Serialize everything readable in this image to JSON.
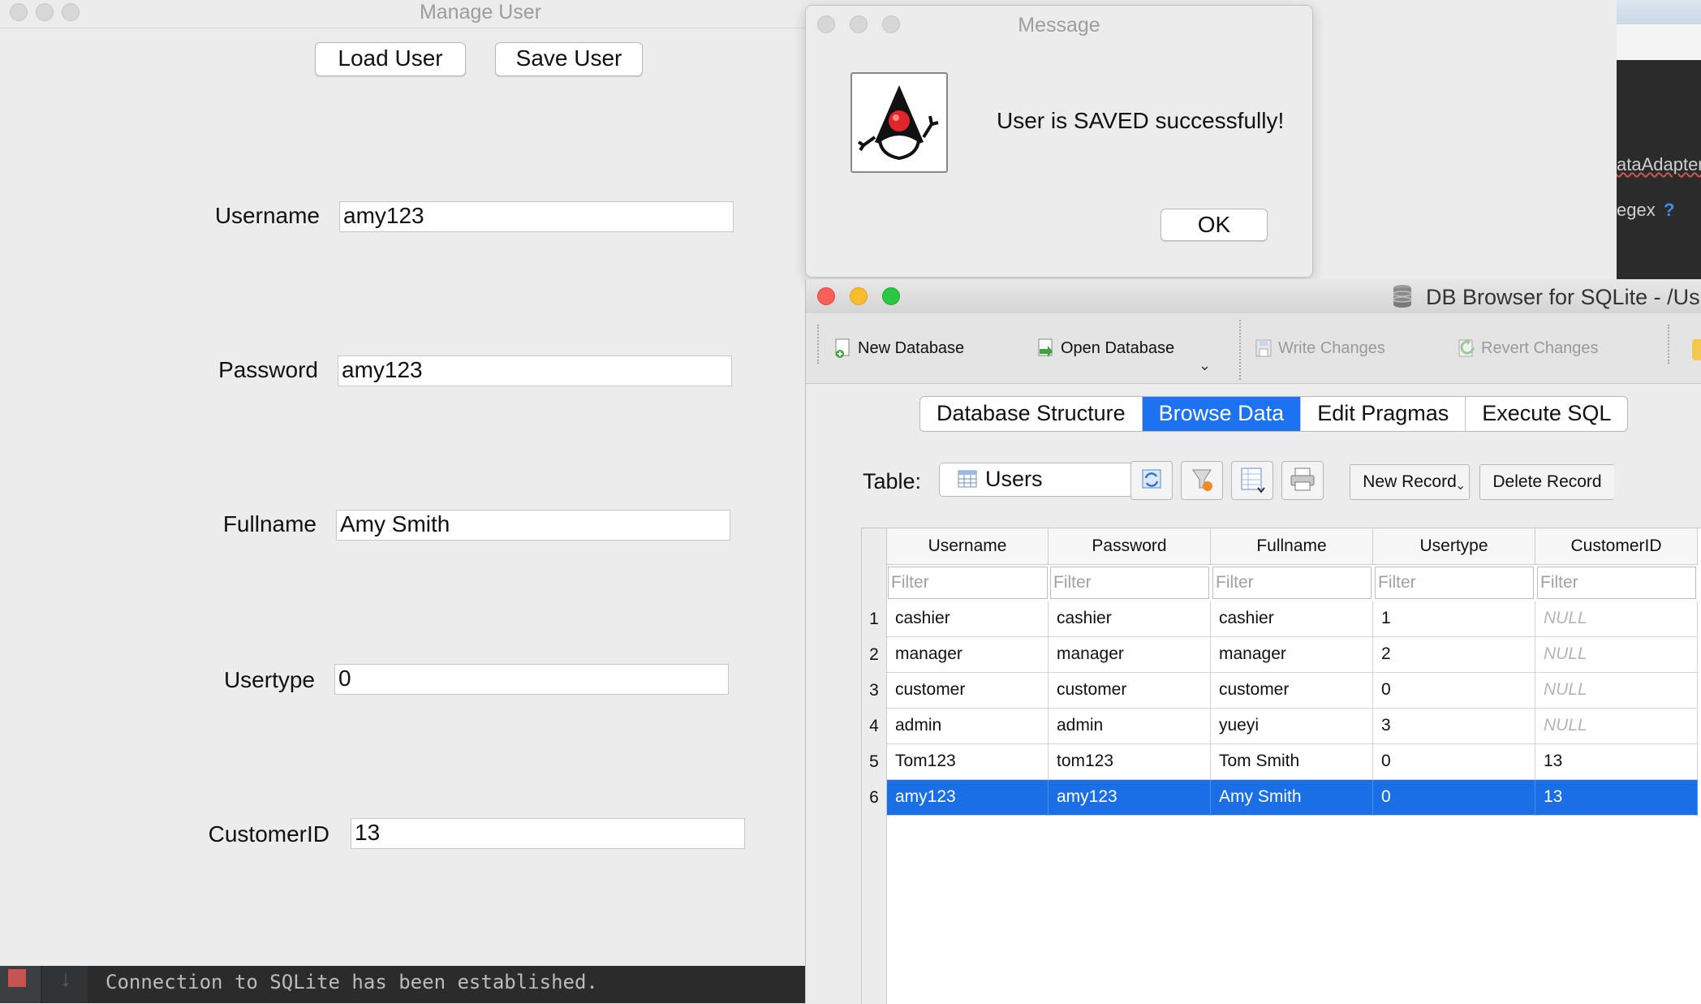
{
  "manage_user": {
    "title": "Manage User",
    "load_button": "Load User",
    "save_button": "Save User",
    "fields": [
      {
        "label": "Username",
        "value": "amy123"
      },
      {
        "label": "Password",
        "value": "amy123"
      },
      {
        "label": "Fullname",
        "value": "Amy Smith"
      },
      {
        "label": "Usertype",
        "value": "0"
      },
      {
        "label": "CustomerID",
        "value": "13"
      }
    ]
  },
  "console": {
    "text": "Connection to SQLite has been established."
  },
  "message_dialog": {
    "title": "Message",
    "text": "User is SAVED successfully!",
    "ok_button": "OK"
  },
  "db_browser": {
    "title": "DB Browser for SQLite - /Us",
    "toolbar": {
      "new_database": "New Database",
      "open_database": "Open Database",
      "write_changes": "Write Changes",
      "revert_changes": "Revert Changes"
    },
    "tabs": [
      "Database Structure",
      "Browse Data",
      "Edit Pragmas",
      "Execute SQL"
    ],
    "active_tab": "Browse Data",
    "table_label": "Table:",
    "table_selected": "Users",
    "new_record": "New Record",
    "delete_record": "Delete Record",
    "columns": [
      "Username",
      "Password",
      "Fullname",
      "Usertype",
      "CustomerID"
    ],
    "filter_placeholder": "Filter",
    "rows": [
      [
        "1",
        "cashier",
        "cashier",
        "cashier",
        "1",
        "NULL"
      ],
      [
        "2",
        "manager",
        "manager",
        "manager",
        "2",
        "NULL"
      ],
      [
        "3",
        "customer",
        "customer",
        "customer",
        "0",
        "NULL"
      ],
      [
        "4",
        "admin",
        "admin",
        "yueyi",
        "3",
        "NULL"
      ],
      [
        "5",
        "Tom123",
        "tom123",
        "Tom Smith",
        "0",
        "13"
      ],
      [
        "6",
        "amy123",
        "amy123",
        "Amy Smith",
        "0",
        "13"
      ]
    ],
    "selected_row": 6
  },
  "ide_background": {
    "text1": "ataAdapter",
    "text2": "egex",
    "help": "?"
  }
}
